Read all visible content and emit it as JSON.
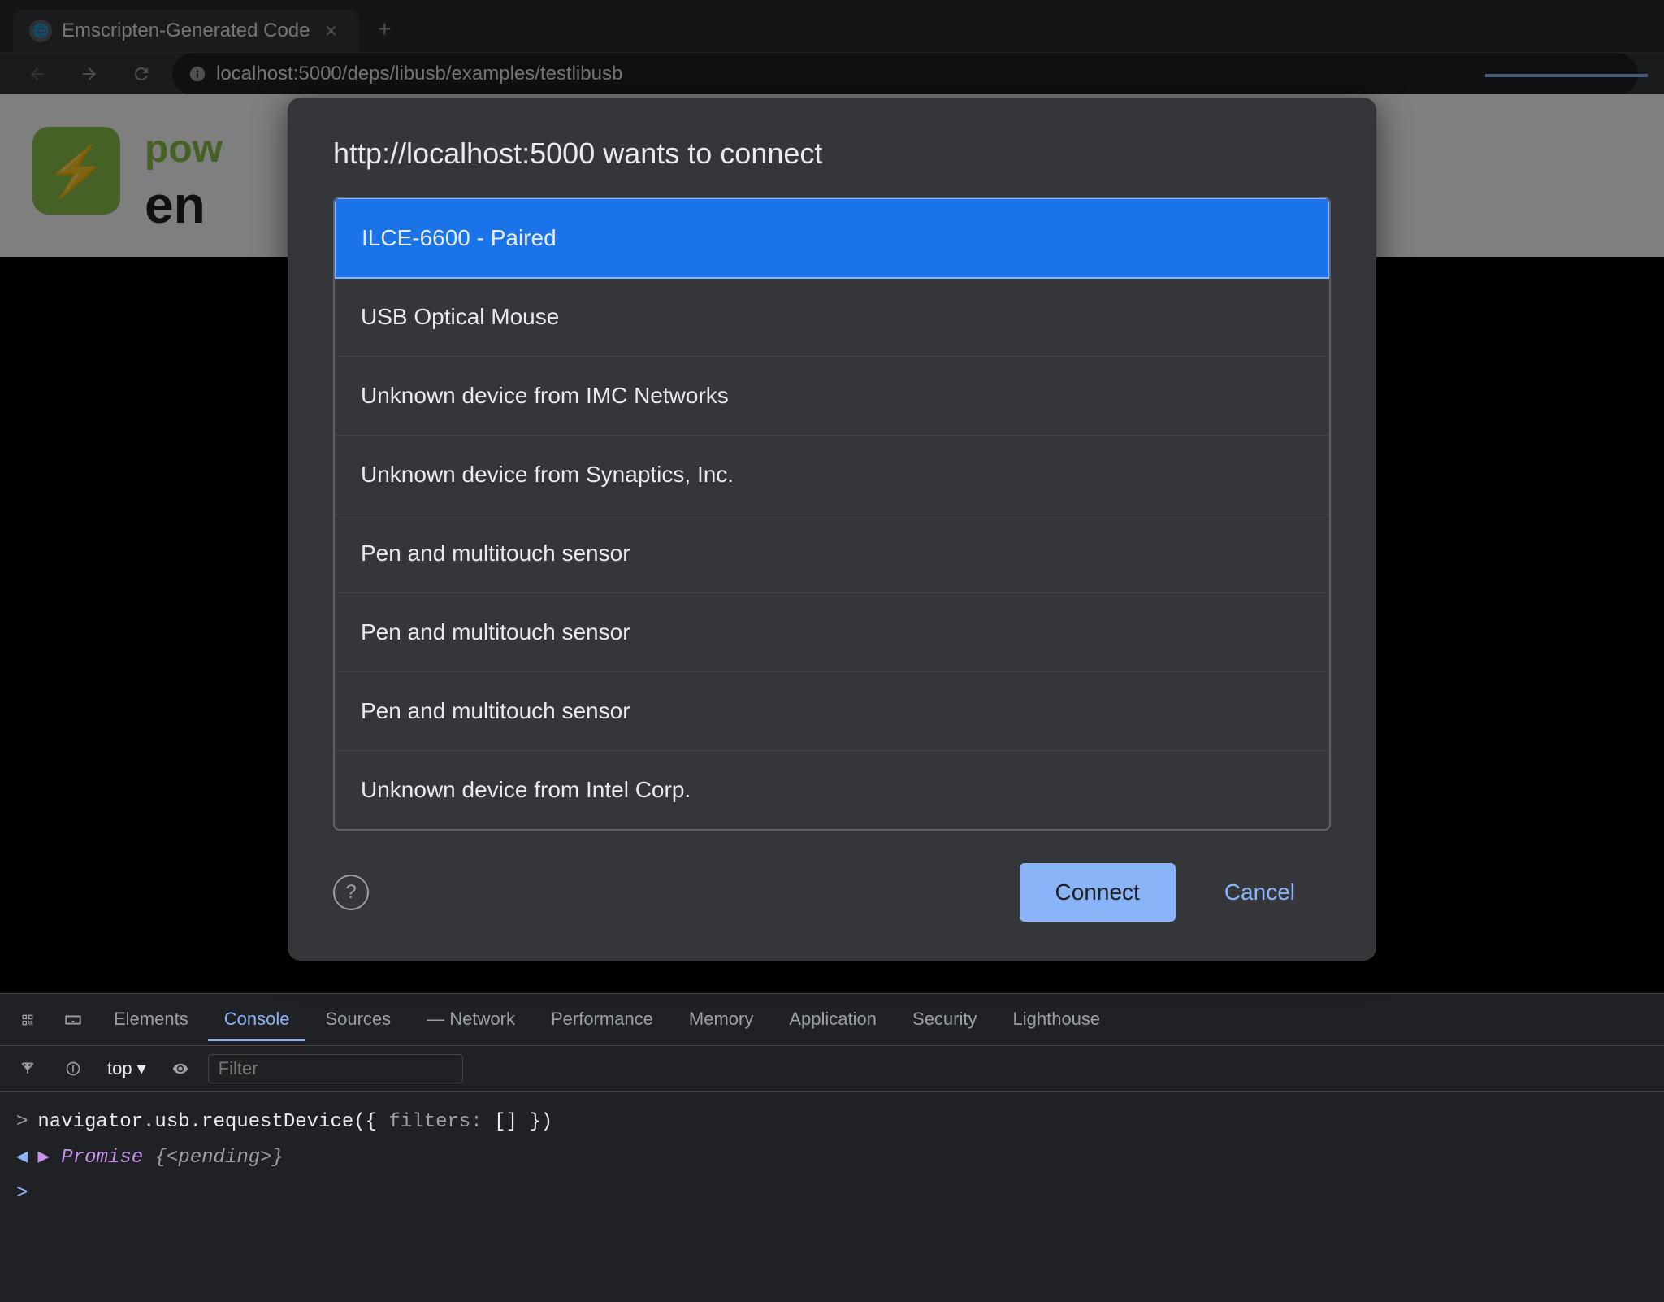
{
  "browser": {
    "tab": {
      "title": "Emscripten-Generated Code",
      "favicon": "🌐"
    },
    "new_tab_icon": "+",
    "address": "localhost:5000/deps/libusb/examples/testlibusb",
    "nav": {
      "back": "←",
      "forward": "→",
      "reload": "↻"
    }
  },
  "page": {
    "icon": "⚡",
    "text_pow": "pow",
    "text_en": "en"
  },
  "dialog": {
    "title": "http://localhost:5000 wants to connect",
    "devices": [
      {
        "label": "ILCE-6600 - Paired",
        "selected": true
      },
      {
        "label": "USB Optical Mouse",
        "selected": false
      },
      {
        "label": "Unknown device from IMC Networks",
        "selected": false
      },
      {
        "label": "Unknown device from Synaptics, Inc.",
        "selected": false
      },
      {
        "label": "Pen and multitouch sensor",
        "selected": false
      },
      {
        "label": "Pen and multitouch sensor",
        "selected": false
      },
      {
        "label": "Pen and multitouch sensor",
        "selected": false
      },
      {
        "label": "Unknown device from Intel Corp.",
        "selected": false
      }
    ],
    "connect_label": "Connect",
    "cancel_label": "Cancel"
  },
  "devtools": {
    "tabs": [
      {
        "label": "Elements",
        "active": false
      },
      {
        "label": "Console",
        "active": true
      },
      {
        "label": "Sources",
        "active": false
      },
      {
        "label": "Network",
        "active": false
      },
      {
        "label": "Performance",
        "active": false
      },
      {
        "label": "Memory",
        "active": false
      },
      {
        "label": "Application",
        "active": false
      },
      {
        "label": "Security",
        "active": false
      },
      {
        "label": "Lighthouse",
        "active": false
      }
    ],
    "toolbar": {
      "top_label": "top",
      "filter_placeholder": "Filter"
    },
    "console": {
      "line1": "navigator.usb.requestDevice({ filters: [] })",
      "line2_prefix": "▶",
      "line2": "Promise {<pending>}"
    }
  }
}
